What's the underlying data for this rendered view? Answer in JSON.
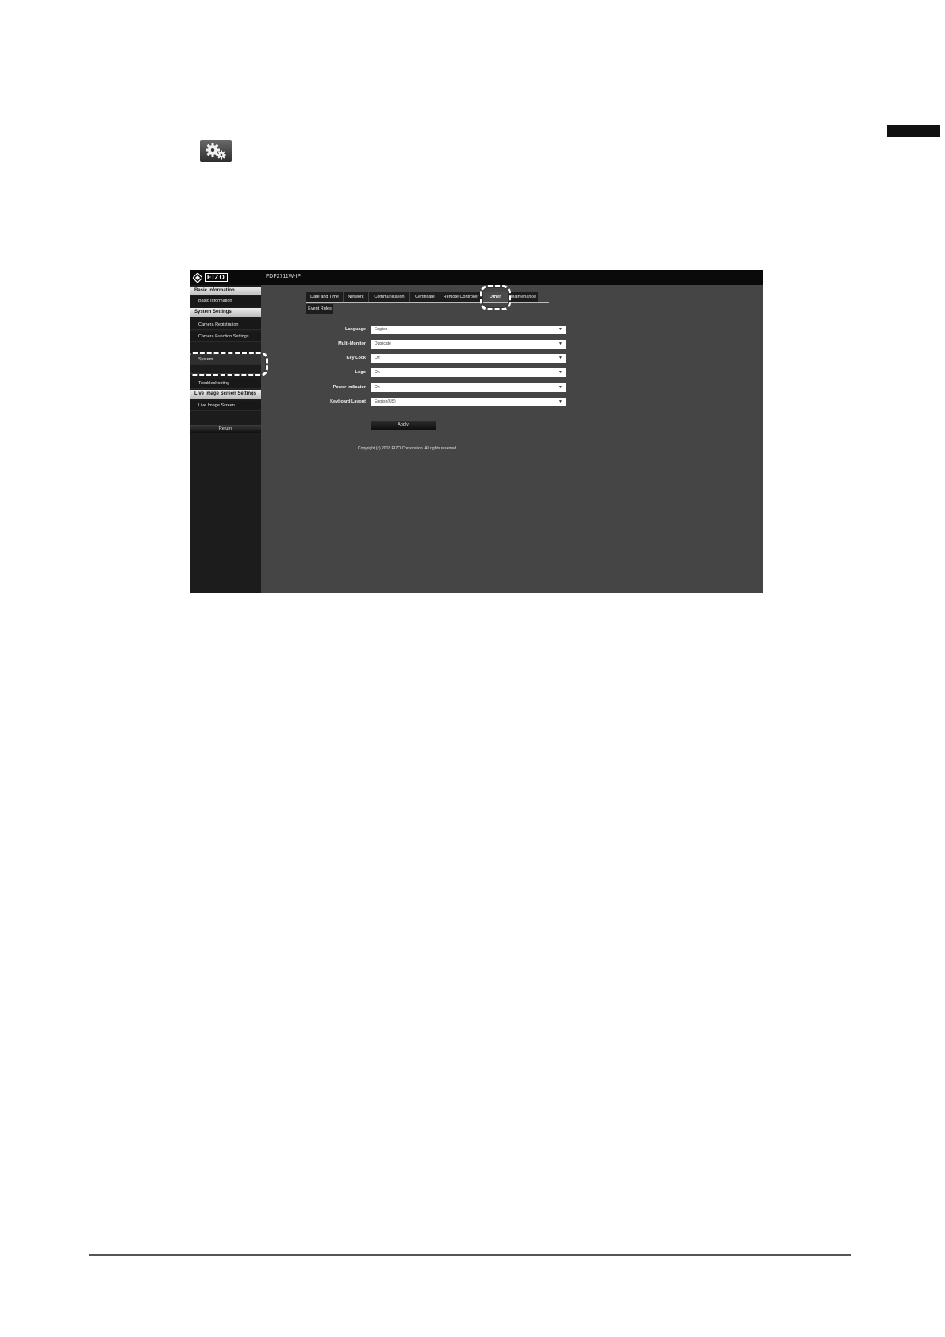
{
  "window": {
    "model": "FDF2711W-IP",
    "logo_text": "EIZO"
  },
  "sidebar": {
    "sections": [
      {
        "header": "Basic Information",
        "items": [
          "Basic Information"
        ]
      },
      {
        "header": "System Settings",
        "items": [
          "Camera Registration",
          "Camera Function Settings",
          "System",
          "Troubleshooting"
        ]
      },
      {
        "header": "Live Image Screen Settings",
        "items": [
          "Live Image Screen"
        ]
      }
    ],
    "selected": "System",
    "return_label": "Return"
  },
  "tabs": [
    "Date and Time",
    "Network",
    "Communication",
    "Certificate",
    "Remote Controller",
    "Other",
    "Maintenance",
    "Event Rules"
  ],
  "active_tab": "Other",
  "form": {
    "fields": [
      {
        "label": "Language",
        "value": "English"
      },
      {
        "label": "Multi-Monitor",
        "value": "Duplicate"
      },
      {
        "label": "Key Lock",
        "value": "Off"
      },
      {
        "label": "Logo",
        "value": "On"
      },
      {
        "label": "Power Indicator",
        "value": "On"
      },
      {
        "label": "Keyboard Layout",
        "value": "English(US)"
      }
    ],
    "apply_label": "Apply"
  },
  "copyright": "Copyright (c) 2018 EIZO Corporation. All rights reserved.",
  "icons": {
    "settings": "gear-icon",
    "dropdown": "caret-down-icon"
  },
  "colors": {
    "topbar": "#0a0a0a",
    "content_bg": "#454545",
    "sidebar_bg": "#1c1c1c",
    "callout": "#ffffff"
  }
}
